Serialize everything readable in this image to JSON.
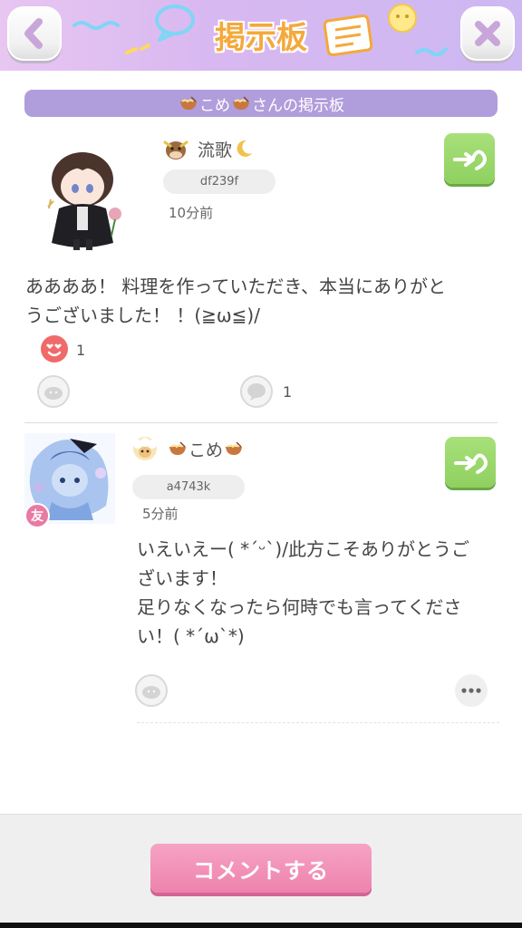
{
  "header": {
    "title": "掲示板"
  },
  "board": {
    "title_name": "こめ",
    "title_suffix": "さんの掲示板"
  },
  "posts": [
    {
      "user_name": "流歌",
      "user_id": "df239f",
      "time": "10分前",
      "text": "ああああ！ 料理を作っていただき、本当にありがと\nうございました！ ！(≧ω≦)/",
      "reaction_count": "1",
      "comment_count": "1"
    },
    {
      "user_name": "こめ",
      "user_id": "a4743k",
      "time": "5分前",
      "friend_label": "友",
      "text": "いえいえー( *´ᵕ`)/此方こそありがとうご\nざいます！\n足りなくなったら何時でも言ってくださ\nい！( *´ω`*)"
    }
  ],
  "footer": {
    "comment_button": "コメントする"
  },
  "colors": {
    "header_bg": "#d8b8f0",
    "title_orange": "#f4a93a",
    "board_bar": "#b09ddb",
    "green_button": "#9bd86c",
    "pink_button": "#ee83ad"
  }
}
